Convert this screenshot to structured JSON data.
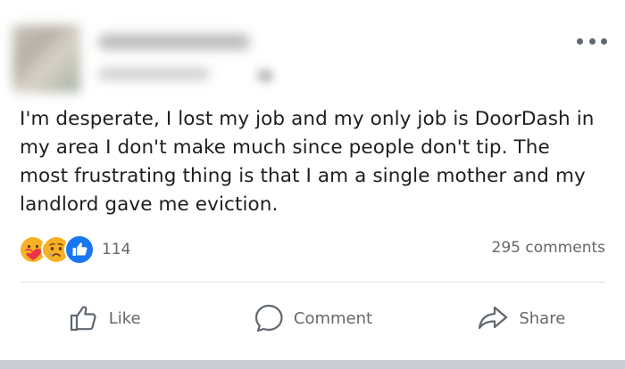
{
  "post": {
    "text": "I'm desperate, I lost my job and my only job is DoorDash in my area I don't make much since people don't tip. The most frustrating thing is that I am a single mother and my landlord gave me eviction."
  },
  "reactions": {
    "icons": [
      "care-reaction-icon",
      "sad-reaction-icon",
      "like-reaction-icon"
    ],
    "count": "114"
  },
  "comments": {
    "count_label": "295 comments"
  },
  "actions": {
    "like_label": "Like",
    "comment_label": "Comment",
    "share_label": "Share"
  },
  "colors": {
    "text": "#1c1e21",
    "secondary": "#65676b",
    "like_blue": "#1877f2",
    "reaction_yellow": "#f7b125"
  }
}
